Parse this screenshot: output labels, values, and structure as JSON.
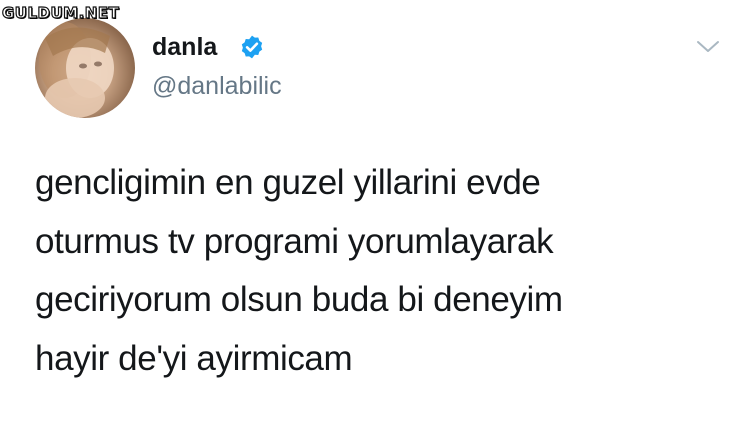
{
  "watermark": "GULDUM.NET",
  "profile": {
    "display_name": "danla",
    "handle": "@danlabilic",
    "verified": true,
    "badge_color": "#1da1f2"
  },
  "tweet": {
    "lines": [
      "gencligimin en guzel yillarini evde",
      "oturmus tv programi yorumlayarak",
      "geciriyorum olsun buda bi deneyim",
      "hayir de'yi ayirmicam"
    ]
  },
  "icons": {
    "menu": "chevron-down-icon",
    "verified": "verified-badge-icon"
  }
}
